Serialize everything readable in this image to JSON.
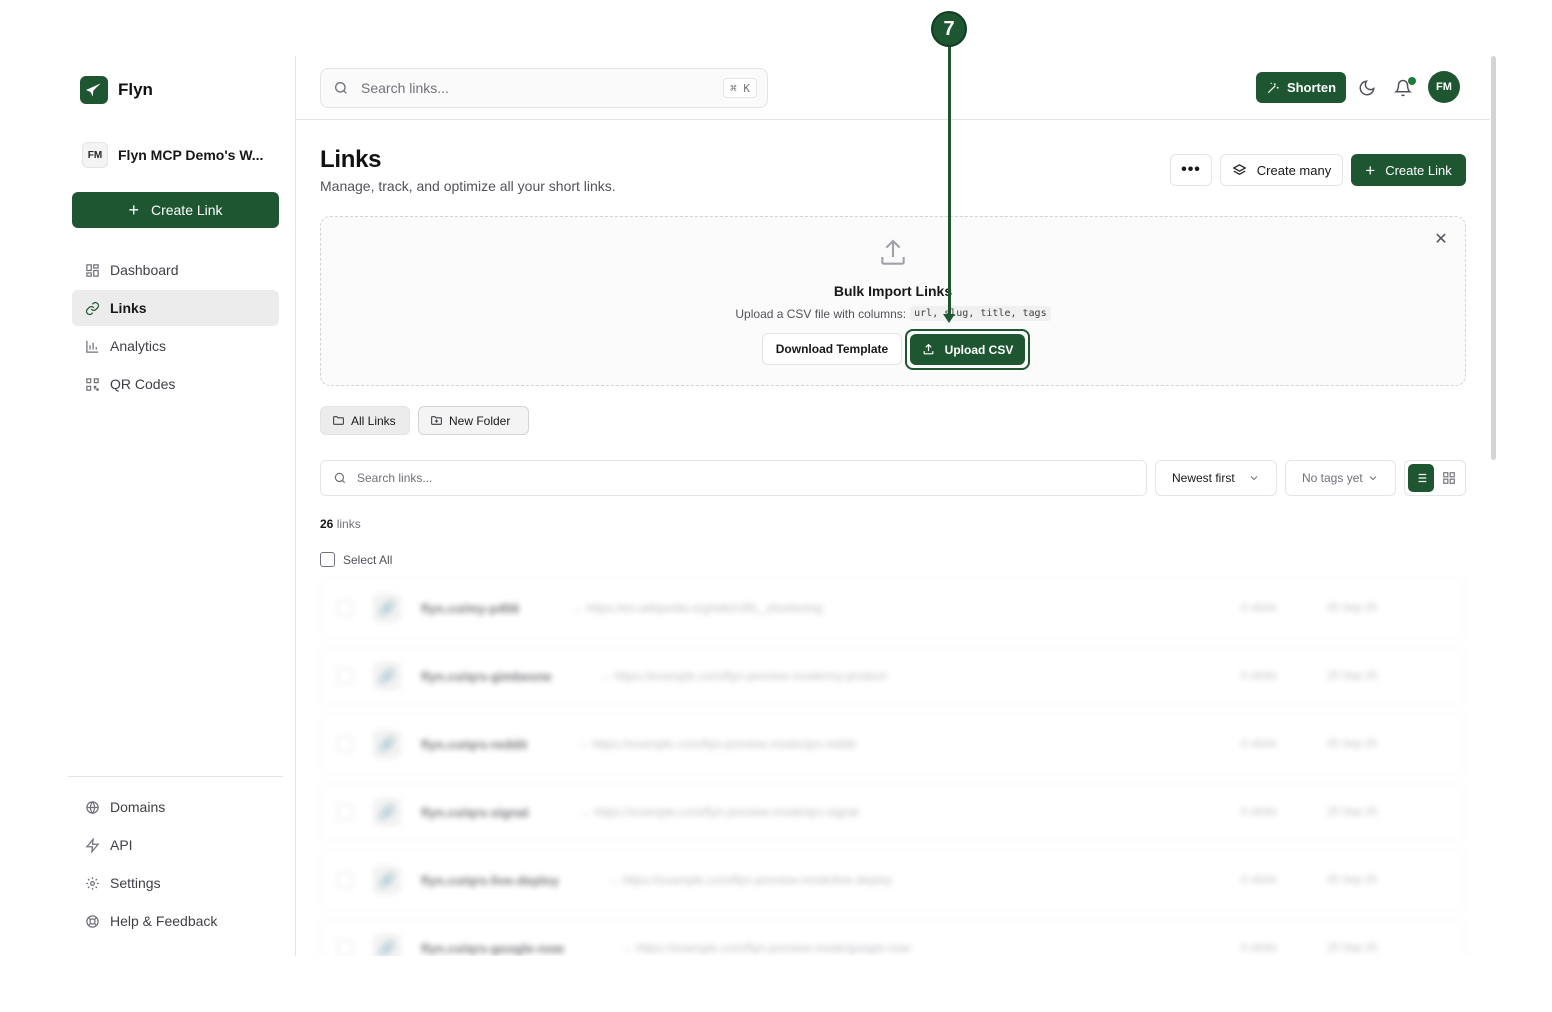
{
  "brand": {
    "name": "Flyn"
  },
  "workspace": {
    "initials": "FM",
    "name": "Flyn MCP Demo's W..."
  },
  "sidebar": {
    "create_label": "Create Link",
    "items": [
      {
        "label": "Dashboard",
        "icon": "dashboard-icon",
        "active": false
      },
      {
        "label": "Links",
        "icon": "link-icon",
        "active": true
      },
      {
        "label": "Analytics",
        "icon": "analytics-icon",
        "active": false
      },
      {
        "label": "QR Codes",
        "icon": "qr-code-icon",
        "active": false
      }
    ],
    "bottom_items": [
      {
        "label": "Domains",
        "icon": "globe-icon"
      },
      {
        "label": "API",
        "icon": "zap-icon"
      },
      {
        "label": "Settings",
        "icon": "gear-icon"
      },
      {
        "label": "Help & Feedback",
        "icon": "help-icon"
      }
    ]
  },
  "topbar": {
    "search_placeholder": "Search links...",
    "shortcut": "⌘ K",
    "shorten_label": "Shorten",
    "avatar_initials": "FM"
  },
  "page": {
    "title": "Links",
    "subtitle": "Manage, track, and optimize all your short links.",
    "more_label": "•••",
    "create_many_label": "Create many",
    "create_link_label": "Create Link"
  },
  "bulk_import": {
    "title": "Bulk Import Links",
    "description": "Upload a CSV file with columns:",
    "columns": "url, slug, title, tags",
    "close_label": "✕",
    "download_label": "Download Template",
    "upload_label": "Upload CSV"
  },
  "folders": {
    "all_label": "All Links",
    "new_label": "New Folder"
  },
  "filters": {
    "search_placeholder": "Search links...",
    "sort_value": "Newest first",
    "tags_value": "No tags yet"
  },
  "list": {
    "count": "26",
    "count_suffix": "links",
    "select_all_label": "Select All",
    "rows": [
      {
        "slug": "flyn.co/my-p456",
        "url": "→ https://en.wikipedia.org/wiki/URL_shortening",
        "clicks": "0 clicks",
        "date": "25 Sep 25"
      },
      {
        "slug": "flyn.co/qrs-gimbesne",
        "url": "→ https://example.com/flyn-preview-mode/my-product",
        "clicks": "0 clicks",
        "date": "25 Sep 25"
      },
      {
        "slug": "flyn.co/qrs-reddit",
        "url": "→ https://example.com/flyn-preview-mode/qrs-reddit",
        "clicks": "0 clicks",
        "date": "25 Sep 25"
      },
      {
        "slug": "flyn.co/qrs-signal",
        "url": "→ https://example.com/flyn-preview-mode/qrs-signal",
        "clicks": "0 clicks",
        "date": "25 Sep 25"
      },
      {
        "slug": "flyn.co/qrs-live-deploy",
        "url": "→ https://example.com/flyn-preview-mode/live-deploy",
        "clicks": "0 clicks",
        "date": "25 Sep 25"
      },
      {
        "slug": "flyn.co/qrs-google-now",
        "url": "→ https://example.com/flyn-preview-mode/google-now",
        "clicks": "0 clicks",
        "date": "25 Sep 25"
      }
    ]
  },
  "annotation": {
    "step": "7"
  },
  "colors": {
    "accent": "#1e5631",
    "border": "#e4e4e7",
    "muted": "#71717a"
  }
}
